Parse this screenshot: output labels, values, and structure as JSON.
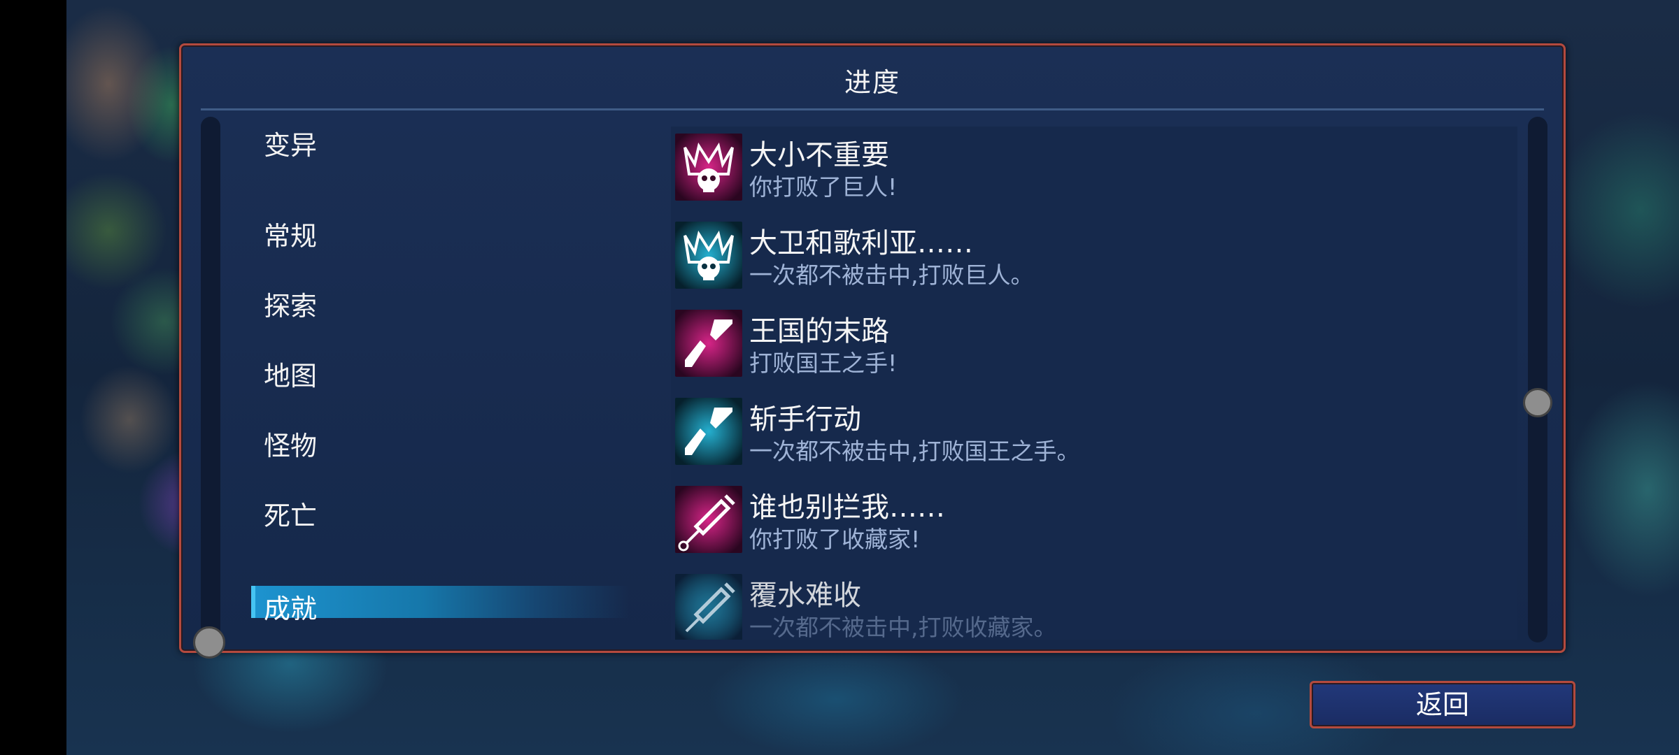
{
  "panel": {
    "title": "进度"
  },
  "sidebar": {
    "items": [
      {
        "label": "变异"
      },
      {
        "label": "常规"
      },
      {
        "label": "探索"
      },
      {
        "label": "地图"
      },
      {
        "label": "怪物"
      },
      {
        "label": "死亡"
      },
      {
        "label": "成就"
      }
    ],
    "selected_index": 6
  },
  "achievements": [
    {
      "name": "大小不重要",
      "desc": "你打败了巨人!",
      "icon": "skull-crown-icon",
      "color": "#e0248a"
    },
    {
      "name": "大卫和歌利亚……",
      "desc": "一次都不被击中,打败巨人。",
      "icon": "skull-crown-icon",
      "color": "#25b6d6"
    },
    {
      "name": "王国的末路",
      "desc": "打败国王之手!",
      "icon": "broken-blade-icon",
      "color": "#e0248a"
    },
    {
      "name": "斩手行动",
      "desc": "一次都不被击中,打败国王之手。",
      "icon": "broken-blade-icon",
      "color": "#25b6d6"
    },
    {
      "name": "谁也别拦我……",
      "desc": "你打败了收藏家!",
      "icon": "syringe-icon",
      "color": "#e0248a"
    },
    {
      "name": "覆水难收",
      "desc": "一次都不被击中,打败收藏家。",
      "icon": "syringe-icon",
      "color": "#25b6d6"
    }
  ],
  "footer": {
    "back_label": "返回"
  },
  "colors": {
    "frame": "#b44a3e",
    "panel": "#1b2f55",
    "highlight": "#1d93cf",
    "pink": "#e0248a",
    "cyan": "#25b6d6"
  }
}
